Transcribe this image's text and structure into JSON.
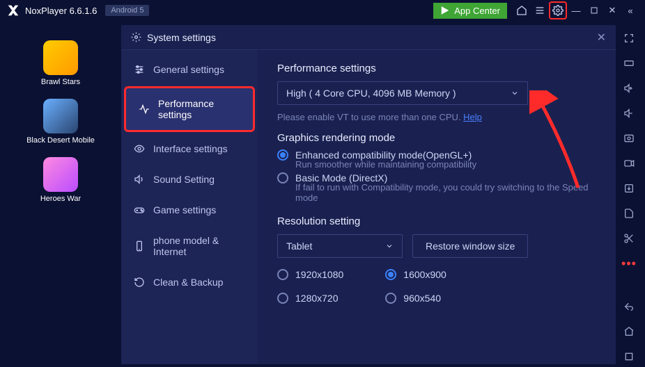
{
  "titlebar": {
    "app_name": "NoxPlayer 6.6.1.6",
    "android_badge": "Android 5",
    "appcenter_label": "App Center"
  },
  "apps": {
    "item0": "Brawl Stars",
    "item1": "Black Desert Mobile",
    "item2": "Heroes War"
  },
  "settings": {
    "title": "System settings",
    "nav": {
      "general": "General settings",
      "performance": "Performance settings",
      "interface": "Interface settings",
      "sound": "Sound Setting",
      "game": "Game settings",
      "phone": "phone model & Internet",
      "clean": "Clean & Backup"
    },
    "perf": {
      "heading": "Performance settings",
      "dropdown_value": "High ( 4 Core CPU, 4096 MB Memory )",
      "vt_hint": "Please enable VT to use more than one CPU. ",
      "vt_help": "Help"
    },
    "graphics": {
      "heading": "Graphics rendering mode",
      "opt1": "Enhanced compatibility mode(OpenGL+)",
      "opt1_sub": "Run smoother while maintaining compatibility",
      "opt2": "Basic Mode (DirectX)",
      "opt2_sub": "If fail to run with Compatibility mode, you could try switching to the Speed mode"
    },
    "resolution": {
      "heading": "Resolution setting",
      "dropdown_value": "Tablet",
      "restore_btn": "Restore window size",
      "r1": "1920x1080",
      "r2": "1600x900",
      "r3": "1280x720",
      "r4": "960x540"
    }
  }
}
